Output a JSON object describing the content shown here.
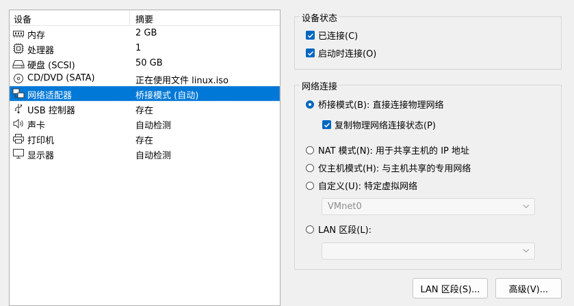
{
  "device_list": {
    "columns": [
      "设备",
      "摘要"
    ],
    "rows": [
      {
        "icon": "memory-icon",
        "name": "内存",
        "value": "2 GB"
      },
      {
        "icon": "processor-icon",
        "name": "处理器",
        "value": "1"
      },
      {
        "icon": "hard-disk-icon",
        "name": "硬盘 (SCSI)",
        "value": "50 GB"
      },
      {
        "icon": "cd-dvd-icon",
        "name": "CD/DVD (SATA)",
        "value": "正在使用文件 linux.iso"
      },
      {
        "icon": "network-adapter-icon",
        "name": "网络适配器",
        "value": "桥接模式 (自动)",
        "selected": true
      },
      {
        "icon": "usb-icon",
        "name": "USB 控制器",
        "value": "存在"
      },
      {
        "icon": "sound-icon",
        "name": "声卡",
        "value": "自动检测"
      },
      {
        "icon": "printer-icon",
        "name": "打印机",
        "value": "存在"
      },
      {
        "icon": "display-icon",
        "name": "显示器",
        "value": "自动检测"
      }
    ]
  },
  "device_status": {
    "title": "设备状态",
    "connected": {
      "label": "已连接(C)",
      "checked": true
    },
    "connect_at_power_on": {
      "label": "启动时连接(O)",
      "checked": true
    }
  },
  "network_connection": {
    "title": "网络连接",
    "bridged": {
      "label": "桥接模式(B): 直接连接物理网络",
      "selected": true
    },
    "replicate": {
      "label": "复制物理网络连接状态(P)",
      "checked": true
    },
    "nat": {
      "label": "NAT 模式(N): 用于共享主机的 IP 地址"
    },
    "host_only": {
      "label": "仅主机模式(H): 与主机共享的专用网络"
    },
    "custom": {
      "label": "自定义(U): 特定虚拟网络"
    },
    "custom_select": {
      "value": "VMnet0"
    },
    "lan_segment": {
      "label": "LAN 区段(L):"
    },
    "lan_select": {
      "value": ""
    }
  },
  "buttons": {
    "lan_segments": "LAN 区段(S)...",
    "advanced": "高级(V)..."
  },
  "colors": {
    "accent": "#0067c0",
    "selection": "#0078d7"
  }
}
